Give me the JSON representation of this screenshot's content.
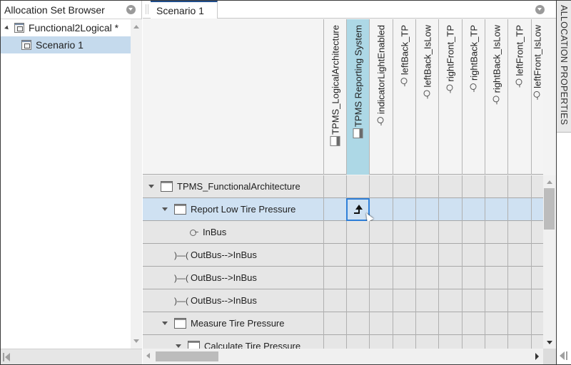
{
  "left_panel": {
    "title": "Allocation Set Browser",
    "menu_icon": "chevron-down-circle-icon",
    "tree": [
      {
        "label": "Functional2Logical *",
        "icon": "allocation-set-icon",
        "expanded": true,
        "selected": false
      },
      {
        "label": "Scenario 1",
        "icon": "scenario-icon",
        "selected": true
      }
    ]
  },
  "main": {
    "tabs": [
      {
        "label": "Scenario 1",
        "active": true
      }
    ],
    "columns": [
      {
        "label": "TPMS_LogicalArchitecture",
        "icon": "component-icon",
        "highlighted": false
      },
      {
        "label": "TPMS Reporting System",
        "icon": "component-icon",
        "highlighted": true
      },
      {
        "label": "indicatorLightEnabled",
        "icon": "port-icon",
        "highlighted": false
      },
      {
        "label": "leftBack_TP",
        "icon": "port-icon",
        "highlighted": false
      },
      {
        "label": "leftBack_IsLow",
        "icon": "port-icon",
        "highlighted": false
      },
      {
        "label": "rightFront_TP",
        "icon": "port-icon",
        "highlighted": false
      },
      {
        "label": "rightBack_TP",
        "icon": "port-icon",
        "highlighted": false
      },
      {
        "label": "rightBack_IsLow",
        "icon": "port-icon",
        "highlighted": false
      },
      {
        "label": "leftFront_TP",
        "icon": "port-icon",
        "highlighted": false
      },
      {
        "label": "leftFront_IsLow",
        "icon": "port-icon",
        "highlighted": false
      }
    ],
    "rows": [
      {
        "label": "TPMS_FunctionalArchitecture",
        "icon": "component-icon",
        "level": 0,
        "expandable": true,
        "selected": false
      },
      {
        "label": "Report Low Tire Pressure",
        "icon": "component-icon",
        "level": 1,
        "expandable": true,
        "selected": true,
        "allocated_column": 1
      },
      {
        "label": "InBus",
        "icon": "port-icon",
        "level": 2,
        "expandable": false,
        "selected": false
      },
      {
        "label": "OutBus-->InBus",
        "icon": "connector-icon",
        "level": 1,
        "expandable": false,
        "selected": false
      },
      {
        "label": "OutBus-->InBus",
        "icon": "connector-icon",
        "level": 1,
        "expandable": false,
        "selected": false
      },
      {
        "label": "OutBus-->InBus",
        "icon": "connector-icon",
        "level": 1,
        "expandable": false,
        "selected": false
      },
      {
        "label": "Measure Tire Pressure",
        "icon": "component-icon",
        "level": 1,
        "expandable": true,
        "selected": false
      },
      {
        "label": "Calculate Tire Pressure",
        "icon": "component-icon",
        "level": 2,
        "expandable": true,
        "selected": false
      }
    ]
  },
  "right_panel": {
    "title": "ALLOCATION PROPERTIES"
  }
}
